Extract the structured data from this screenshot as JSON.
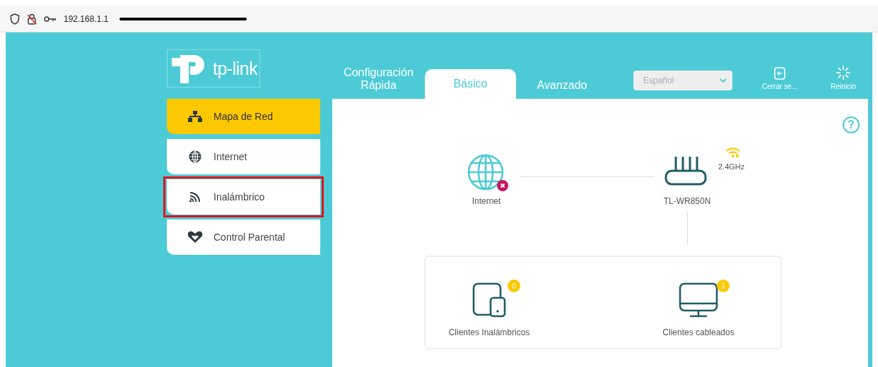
{
  "browser": {
    "address": "192.168.1.1"
  },
  "logo": {
    "text": "tp-link"
  },
  "sidebar": {
    "items": [
      {
        "label": "Mapa de Red",
        "kind": "network",
        "selected": true,
        "highlighted": false
      },
      {
        "label": "Internet",
        "kind": "globe",
        "selected": false,
        "highlighted": false
      },
      {
        "label": "Inalámbrico",
        "kind": "wifi",
        "selected": false,
        "highlighted": true
      },
      {
        "label": "Control Parental",
        "kind": "heart",
        "selected": false,
        "highlighted": false
      }
    ]
  },
  "tabs": [
    {
      "label": "Configuración Rápida",
      "selected": false
    },
    {
      "label": "Básico",
      "selected": true
    },
    {
      "label": "Avanzado",
      "selected": false
    }
  ],
  "language": {
    "value": "Español"
  },
  "actions": [
    {
      "label": "Cerrar se...",
      "kind": "logout"
    },
    {
      "label": "Reinicio",
      "kind": "reboot"
    }
  ],
  "help": "?",
  "map": {
    "internet": {
      "label": "Internet",
      "connected": false
    },
    "router": {
      "label": "TL-WR850N",
      "band": "2.4GHz"
    },
    "clients": [
      {
        "label": "Clientes Inalámbricos",
        "count": "0",
        "kind": "wireless"
      },
      {
        "label": "Clientes cableados",
        "count": "1",
        "kind": "wired"
      }
    ]
  }
}
